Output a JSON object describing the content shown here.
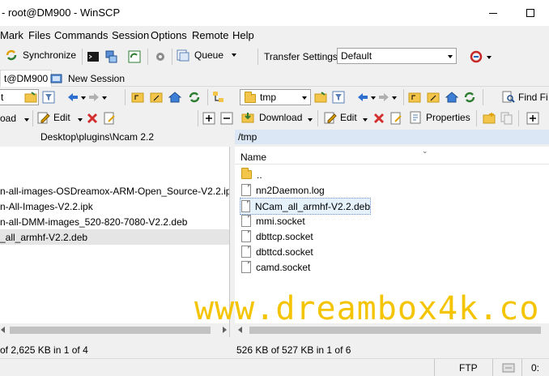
{
  "window": {
    "title": "- root@DM900 - WinSCP"
  },
  "menu": [
    "Mark",
    "Files",
    "Commands",
    "Session",
    "Options",
    "Remote",
    "Help"
  ],
  "toolbar": {
    "synchronize": "Synchronize",
    "queue": "Queue",
    "transfer_settings_label": "Transfer Settings",
    "transfer_settings_value": "Default"
  },
  "tabs": {
    "session": "t@DM900",
    "new_session": "New Session"
  },
  "left": {
    "drive": "t",
    "upload": "oad",
    "edit": "Edit",
    "path": "Desktop\\plugins\\Ncam 2.2",
    "files": [
      "n-all-images-OSDreamox-ARM-Open_Source-V2.2.ipk",
      "n-All-Images-V2.2.ipk",
      "n-all-DMM-images_520-820-7080-V2.2.deb",
      "_all_armhf-V2.2.deb"
    ],
    "status": "of 2,625 KB in 1 of 4"
  },
  "right": {
    "folder": "tmp",
    "download": "Download",
    "edit": "Edit",
    "properties": "Properties",
    "find": "Find Fi",
    "path": "/tmp",
    "column_name": "Name",
    "parent": "..",
    "files": [
      "nn2Daemon.log",
      "NCam_all_armhf-V2.2.deb",
      "mmi.socket",
      "dbttcp.socket",
      "dbttcd.socket",
      "camd.socket"
    ],
    "status": "526 KB of 527 KB in 1 of 6"
  },
  "bottom": {
    "protocol": "FTP",
    "time": "0:"
  },
  "watermark": "www.dreambox4k.co",
  "colors": {
    "watermark": "#f5c400",
    "selection": "#e5f1fb",
    "folder": "#f3c54b"
  }
}
